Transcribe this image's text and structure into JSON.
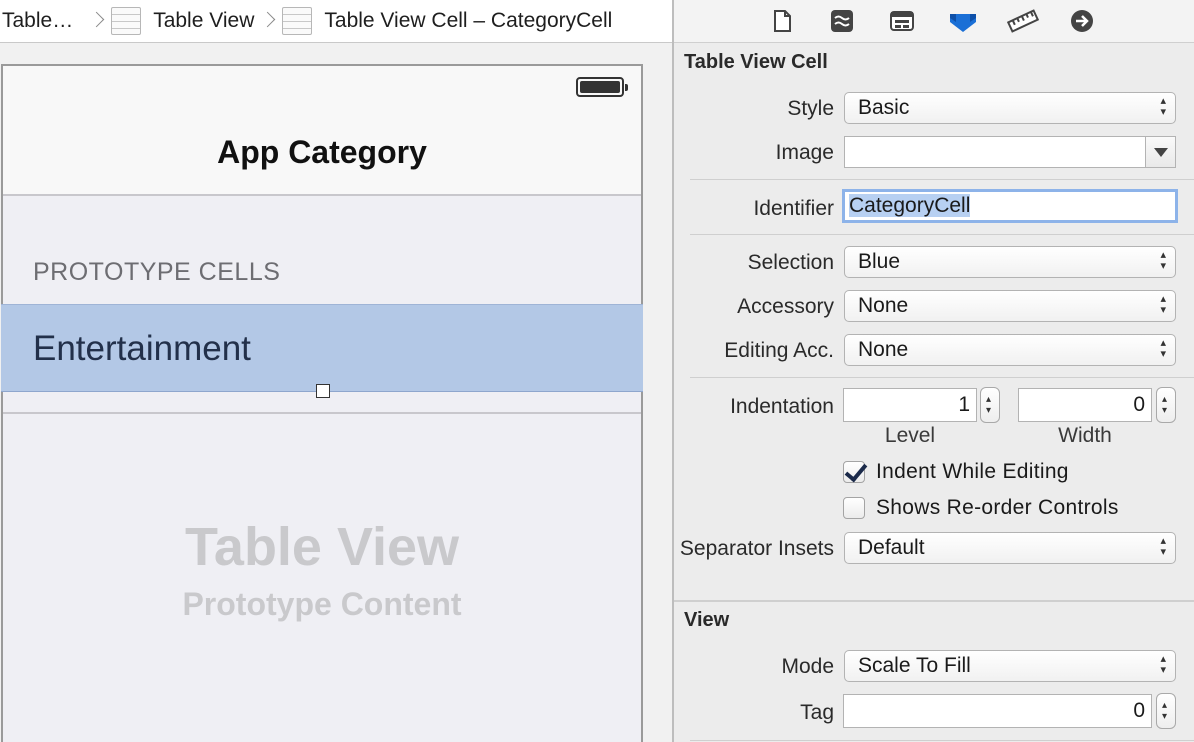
{
  "breadcrumb": {
    "items": [
      "Table…",
      "Table View",
      "Table View Cell – CategoryCell"
    ]
  },
  "canvas": {
    "nav_title": "App Category",
    "section_header": "PROTOTYPE CELLS",
    "cell_label": "Entertainment",
    "placeholder_title": "Table View",
    "placeholder_subtitle": "Prototype Content"
  },
  "inspector": {
    "toolbar_icons": [
      "file-inspector-icon",
      "quick-help-icon",
      "identity-inspector-icon",
      "attributes-inspector-icon",
      "size-inspector-icon",
      "connections-inspector-icon"
    ],
    "active_tab": "attributes-inspector-icon",
    "accent_color": "#1a6fd6",
    "cell_section": {
      "title": "Table View Cell",
      "style_label": "Style",
      "style_value": "Basic",
      "image_label": "Image",
      "image_value": "",
      "identifier_label": "Identifier",
      "identifier_value": "CategoryCell",
      "selection_label": "Selection",
      "selection_value": "Blue",
      "accessory_label": "Accessory",
      "accessory_value": "None",
      "editing_acc_label": "Editing Acc.",
      "editing_acc_value": "None",
      "indentation_label": "Indentation",
      "indentation_level": "1",
      "indentation_width": "0",
      "level_label": "Level",
      "width_label": "Width",
      "indent_while_editing_label": "Indent While Editing",
      "indent_while_editing_checked": true,
      "reorder_controls_label": "Shows Re-order Controls",
      "reorder_controls_checked": false,
      "separator_insets_label": "Separator Insets",
      "separator_insets_value": "Default"
    },
    "view_section": {
      "title": "View",
      "mode_label": "Mode",
      "mode_value": "Scale To Fill",
      "tag_label": "Tag",
      "tag_value": "0"
    }
  }
}
